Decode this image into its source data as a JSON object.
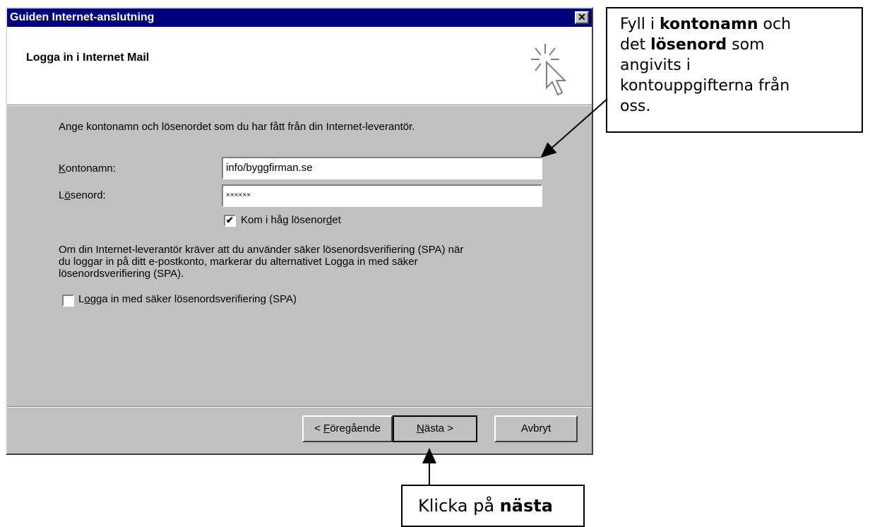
{
  "window": {
    "title": "Guiden Internet-anslutning",
    "close_glyph": "✕"
  },
  "header": {
    "title": "Logga in i Internet Mail",
    "icon": "cursor-sparkle-icon"
  },
  "body": {
    "instruction": "Ange kontonamn och lösenordet som du har fått från din Internet-leverantör.",
    "account_label_key": "K",
    "account_label_rest": "ontonamn:",
    "account_value": "info/byggfirman.se",
    "password_label_pre": "L",
    "password_label_key": "ö",
    "password_label_rest": "senord:",
    "password_value": "××××××",
    "remember_label_pre": "Kom i håg lösenor",
    "remember_label_key": "d",
    "remember_label_rest": "et",
    "remember_checked": "✔",
    "spa_text_line1": "Om din Internet-leverantör kräver att du använder säker lösenordsverifiering (SPA) när",
    "spa_text_line2": "du loggar in på ditt e-postkonto, markerar du alternativet Logga in med säker",
    "spa_text_line3": "lösenordsverifiering (SPA).",
    "spa_label_pre": "L",
    "spa_label_key": "o",
    "spa_label_rest": "gga in med säker lösenordsverifiering (SPA)"
  },
  "buttons": {
    "back_pre": "< ",
    "back_key": "F",
    "back_rest": "öregående",
    "next_key": "N",
    "next_rest": "ästa >",
    "cancel": "Avbryt"
  },
  "callouts": {
    "top_line1_pre": "Fyll i ",
    "top_line1_bold": "kontonamn",
    "top_line1_post": " och",
    "top_line2_pre": "det ",
    "top_line2_bold": "lösenord",
    "top_line2_post": " som",
    "top_line3": "angivits i",
    "top_line4": "kontouppgifterna från",
    "top_line5": "oss.",
    "bottom_pre": "Klicka på ",
    "bottom_bold": "nästa"
  },
  "colors": {
    "titlebar": "#00007b",
    "dialog_face": "#c0c0c0"
  }
}
